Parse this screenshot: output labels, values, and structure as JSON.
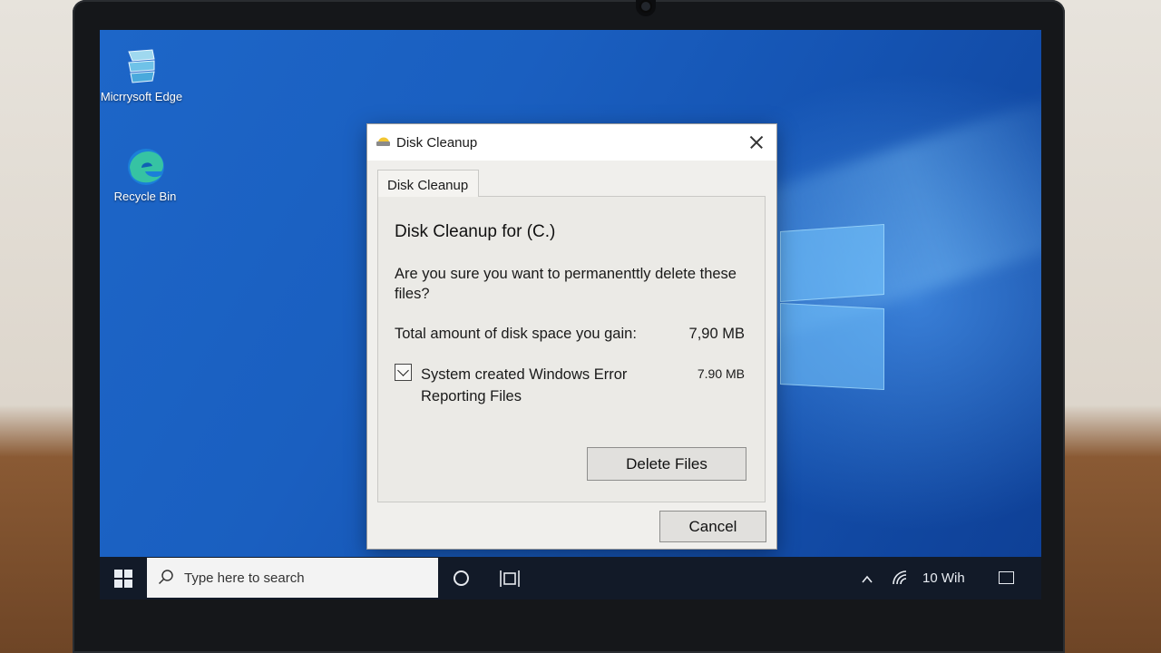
{
  "desktop": {
    "icons": [
      {
        "label": "Micrrysoft Edge"
      },
      {
        "label": "Recycle Bin"
      }
    ]
  },
  "dialog": {
    "title": "Disk Cleanup",
    "tab_label": "Disk Cleanup",
    "heading": "Disk Cleanup  for (C.)",
    "question": "Are you sure you want to permanenttly delete these files?",
    "total_label": "Total amount of disk space you gain:",
    "total_value": "7,90 MB",
    "item": {
      "label": "System created Windows Error Reporting Files",
      "size": "7.90 MB",
      "checked": true
    },
    "delete_button": "Delete Files",
    "cancel_button": "Cancel"
  },
  "taskbar": {
    "search_placeholder": "Type here to search",
    "clock": "10  Wih"
  },
  "colors": {
    "desktop_blue": "#1a5fc0",
    "taskbar": "#121a28",
    "dialog_bg": "#f0efec"
  }
}
